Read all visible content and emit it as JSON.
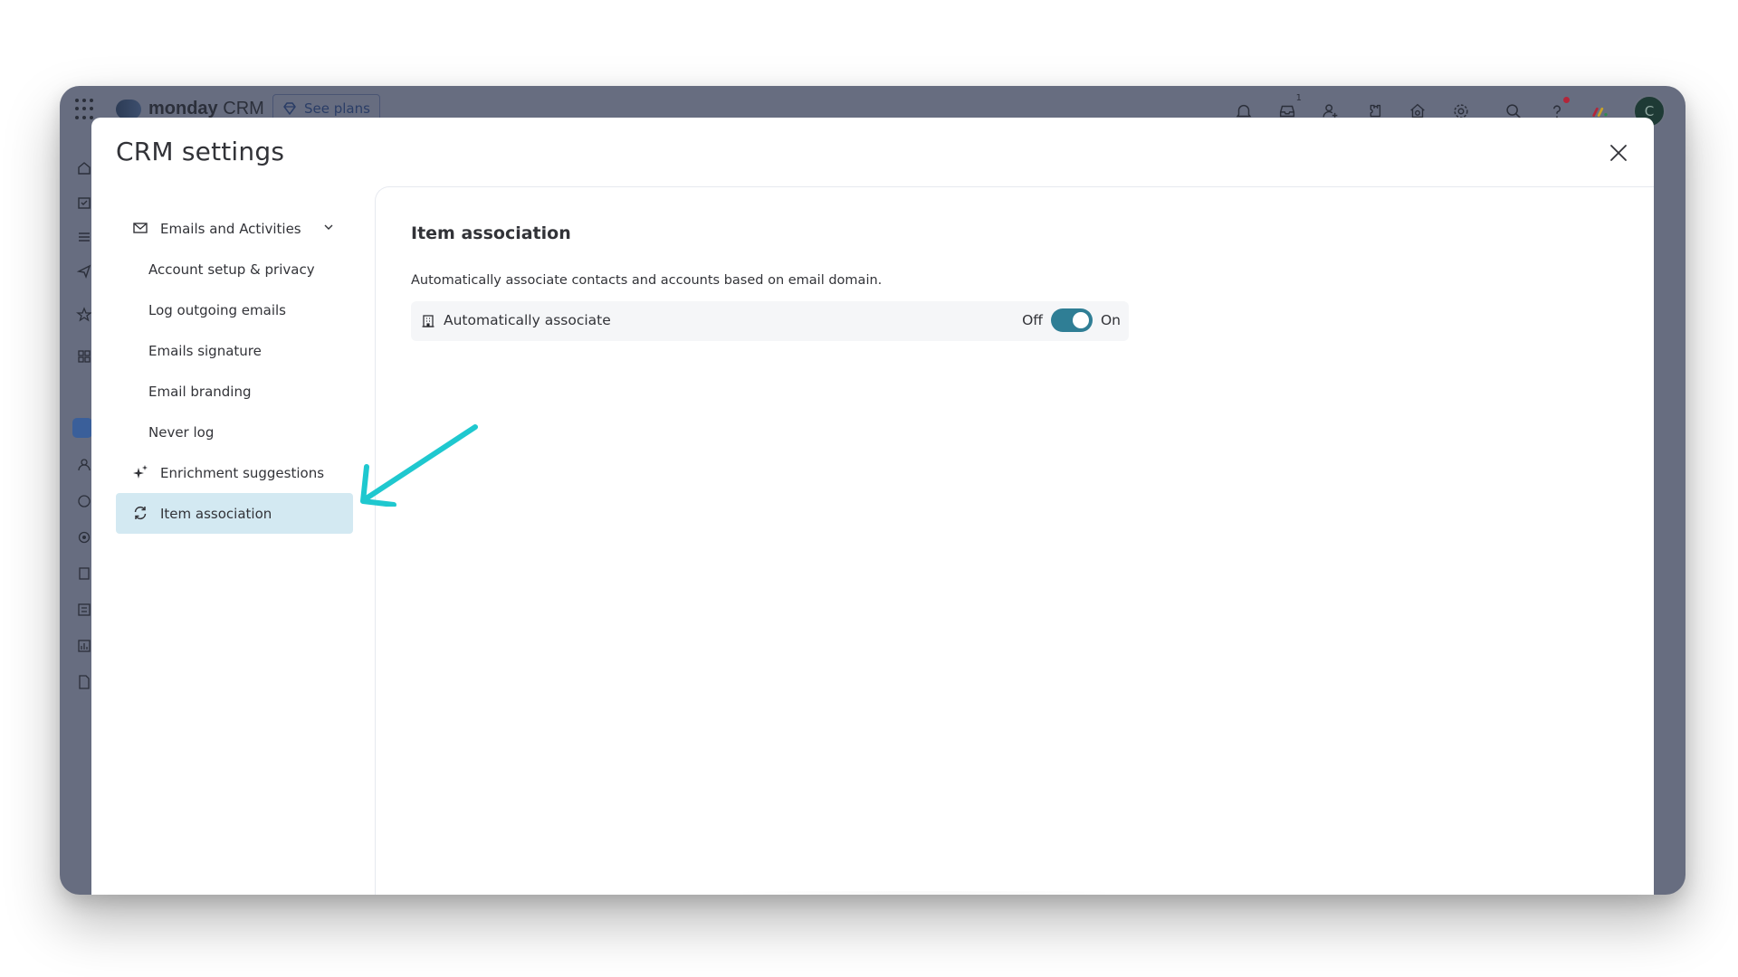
{
  "app": {
    "logo_bold": "monday",
    "logo_light": "CRM",
    "see_plans_label": "See plans",
    "inbox_count": "1",
    "avatar_initial": "C"
  },
  "modal": {
    "title": "CRM settings"
  },
  "nav": {
    "items": [
      {
        "label": "Emails and Activities"
      },
      {
        "label": "Account setup & privacy"
      },
      {
        "label": "Log outgoing emails"
      },
      {
        "label": "Emails signature"
      },
      {
        "label": "Email branding"
      },
      {
        "label": "Never log"
      },
      {
        "label": "Enrichment suggestions"
      },
      {
        "label": "Item association"
      }
    ],
    "active_index": 7
  },
  "content": {
    "title": "Item association",
    "description": "Automatically associate contacts and accounts based on email domain.",
    "setting_label": "Automatically associate",
    "toggle_off_label": "Off",
    "toggle_on_label": "On",
    "toggle_state": "on"
  },
  "colors": {
    "accent": "#2f7e95",
    "active_nav_bg": "#d3e9f2",
    "annotation_arrow": "#1fc8cf",
    "backdrop": "#676d80"
  },
  "icons": {
    "nav_emails": "mail-icon",
    "nav_enrichment": "sparkle-icon",
    "nav_item_association": "sync-icon",
    "setting": "building-icon",
    "close": "close-icon"
  }
}
